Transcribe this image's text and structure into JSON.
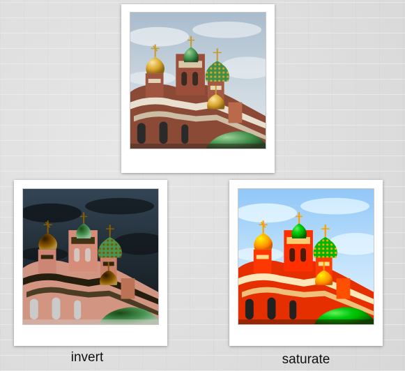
{
  "captions": {
    "invert": "invert",
    "saturate": "saturate"
  },
  "photo_icon": "cathedral-photo",
  "colors": {
    "background": "#dcdcdc",
    "card": "#ffffff",
    "sky": "#b9c8d6",
    "brick": "#8a4a36",
    "gold": "#d9a52b",
    "green": "#3f8f4a",
    "blue": "#2f6fb0"
  }
}
